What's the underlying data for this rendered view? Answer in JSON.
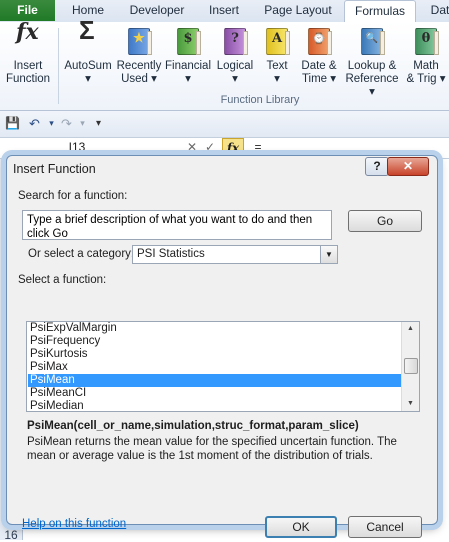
{
  "ribbon_tabs": [
    {
      "label": "File"
    },
    {
      "label": "Home"
    },
    {
      "label": "Developer"
    },
    {
      "label": "Insert"
    },
    {
      "label": "Page Layout"
    },
    {
      "label": "Formulas"
    },
    {
      "label": "Dat"
    }
  ],
  "ribbon": {
    "insert_function": {
      "line1": "Insert",
      "line2": "Function",
      "glyph": "fx"
    },
    "autosum": {
      "label": "AutoSum",
      "glyph": "Σ"
    },
    "recently_used": {
      "line1": "Recently",
      "line2": "Used",
      "glyph": "★"
    },
    "financial": {
      "label": "Financial",
      "glyph": "$"
    },
    "logical": {
      "label": "Logical",
      "glyph": "?"
    },
    "text": {
      "label": "Text",
      "glyph": "A"
    },
    "date_time": {
      "line1": "Date &",
      "line2": "Time",
      "glyph": "⌚"
    },
    "lookup_reference": {
      "line1": "Lookup &",
      "line2": "Reference",
      "glyph": "🔍"
    },
    "math_trig": {
      "line1": "Math",
      "line2": "& Trig",
      "glyph": "θ"
    },
    "dropdown_glyph": "▾",
    "group_label": "Function Library"
  },
  "formula_bar": {
    "cell_ref": "I13",
    "cancel_glyph": "✕",
    "enter_glyph": "✓",
    "fx_glyph": "fx",
    "equals": "="
  },
  "qat": {
    "save_glyph": "💾",
    "undo_glyph": "↶",
    "redo_glyph": "↷",
    "more_glyph": "▾"
  },
  "rows": {
    "bottom_label": "16"
  },
  "dialog": {
    "title": "Insert Function",
    "help_glyph": "?",
    "close_glyph": "✕",
    "search_label": "Search for a function:",
    "search_text": "Type a brief description of what you want to do and then click Go",
    "go_label": "Go",
    "category_label": "Or select a category:",
    "category_value": "PSI Statistics",
    "select_label": "Select a function:",
    "functions": [
      "PsiExpValMargin",
      "PsiFrequency",
      "PsiKurtosis",
      "PsiMax",
      "PsiMean",
      "PsiMeanCI",
      "PsiMedian"
    ],
    "selected_function": "PsiMean",
    "signature": "PsiMean(cell_or_name,simulation,struc_format,param_slice)",
    "description": "PsiMean returns the mean value for the specified uncertain function. The mean or average value is the 1st moment of the distribution of trials.",
    "help_link": "Help on this function",
    "ok_label": "OK",
    "cancel_label": "Cancel"
  },
  "colors": {
    "accent": "#3399ff",
    "file_tab": "#2a8a30",
    "link": "#0066cc"
  }
}
